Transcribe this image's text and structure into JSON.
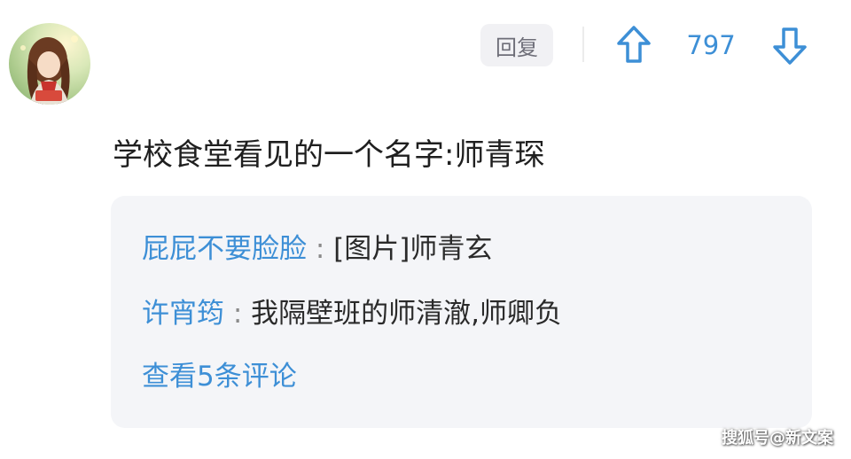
{
  "header": {
    "reply_label": "回复",
    "vote_count": "797",
    "upvote_icon": "arrow-up-icon",
    "downvote_icon": "arrow-down-icon",
    "accent_color": "#3d8fd6"
  },
  "post": {
    "text": "学校食堂看见的一个名字:师青琛"
  },
  "replies": [
    {
      "author": "屁屁不要脸脸",
      "separator": " : ",
      "content": "[图片]师青玄"
    },
    {
      "author": "许宵筠",
      "separator": " : ",
      "content": "我隔壁班的师清澈,师卿负"
    }
  ],
  "view_more": "查看5条评论",
  "watermark": "搜狐号@新文案"
}
